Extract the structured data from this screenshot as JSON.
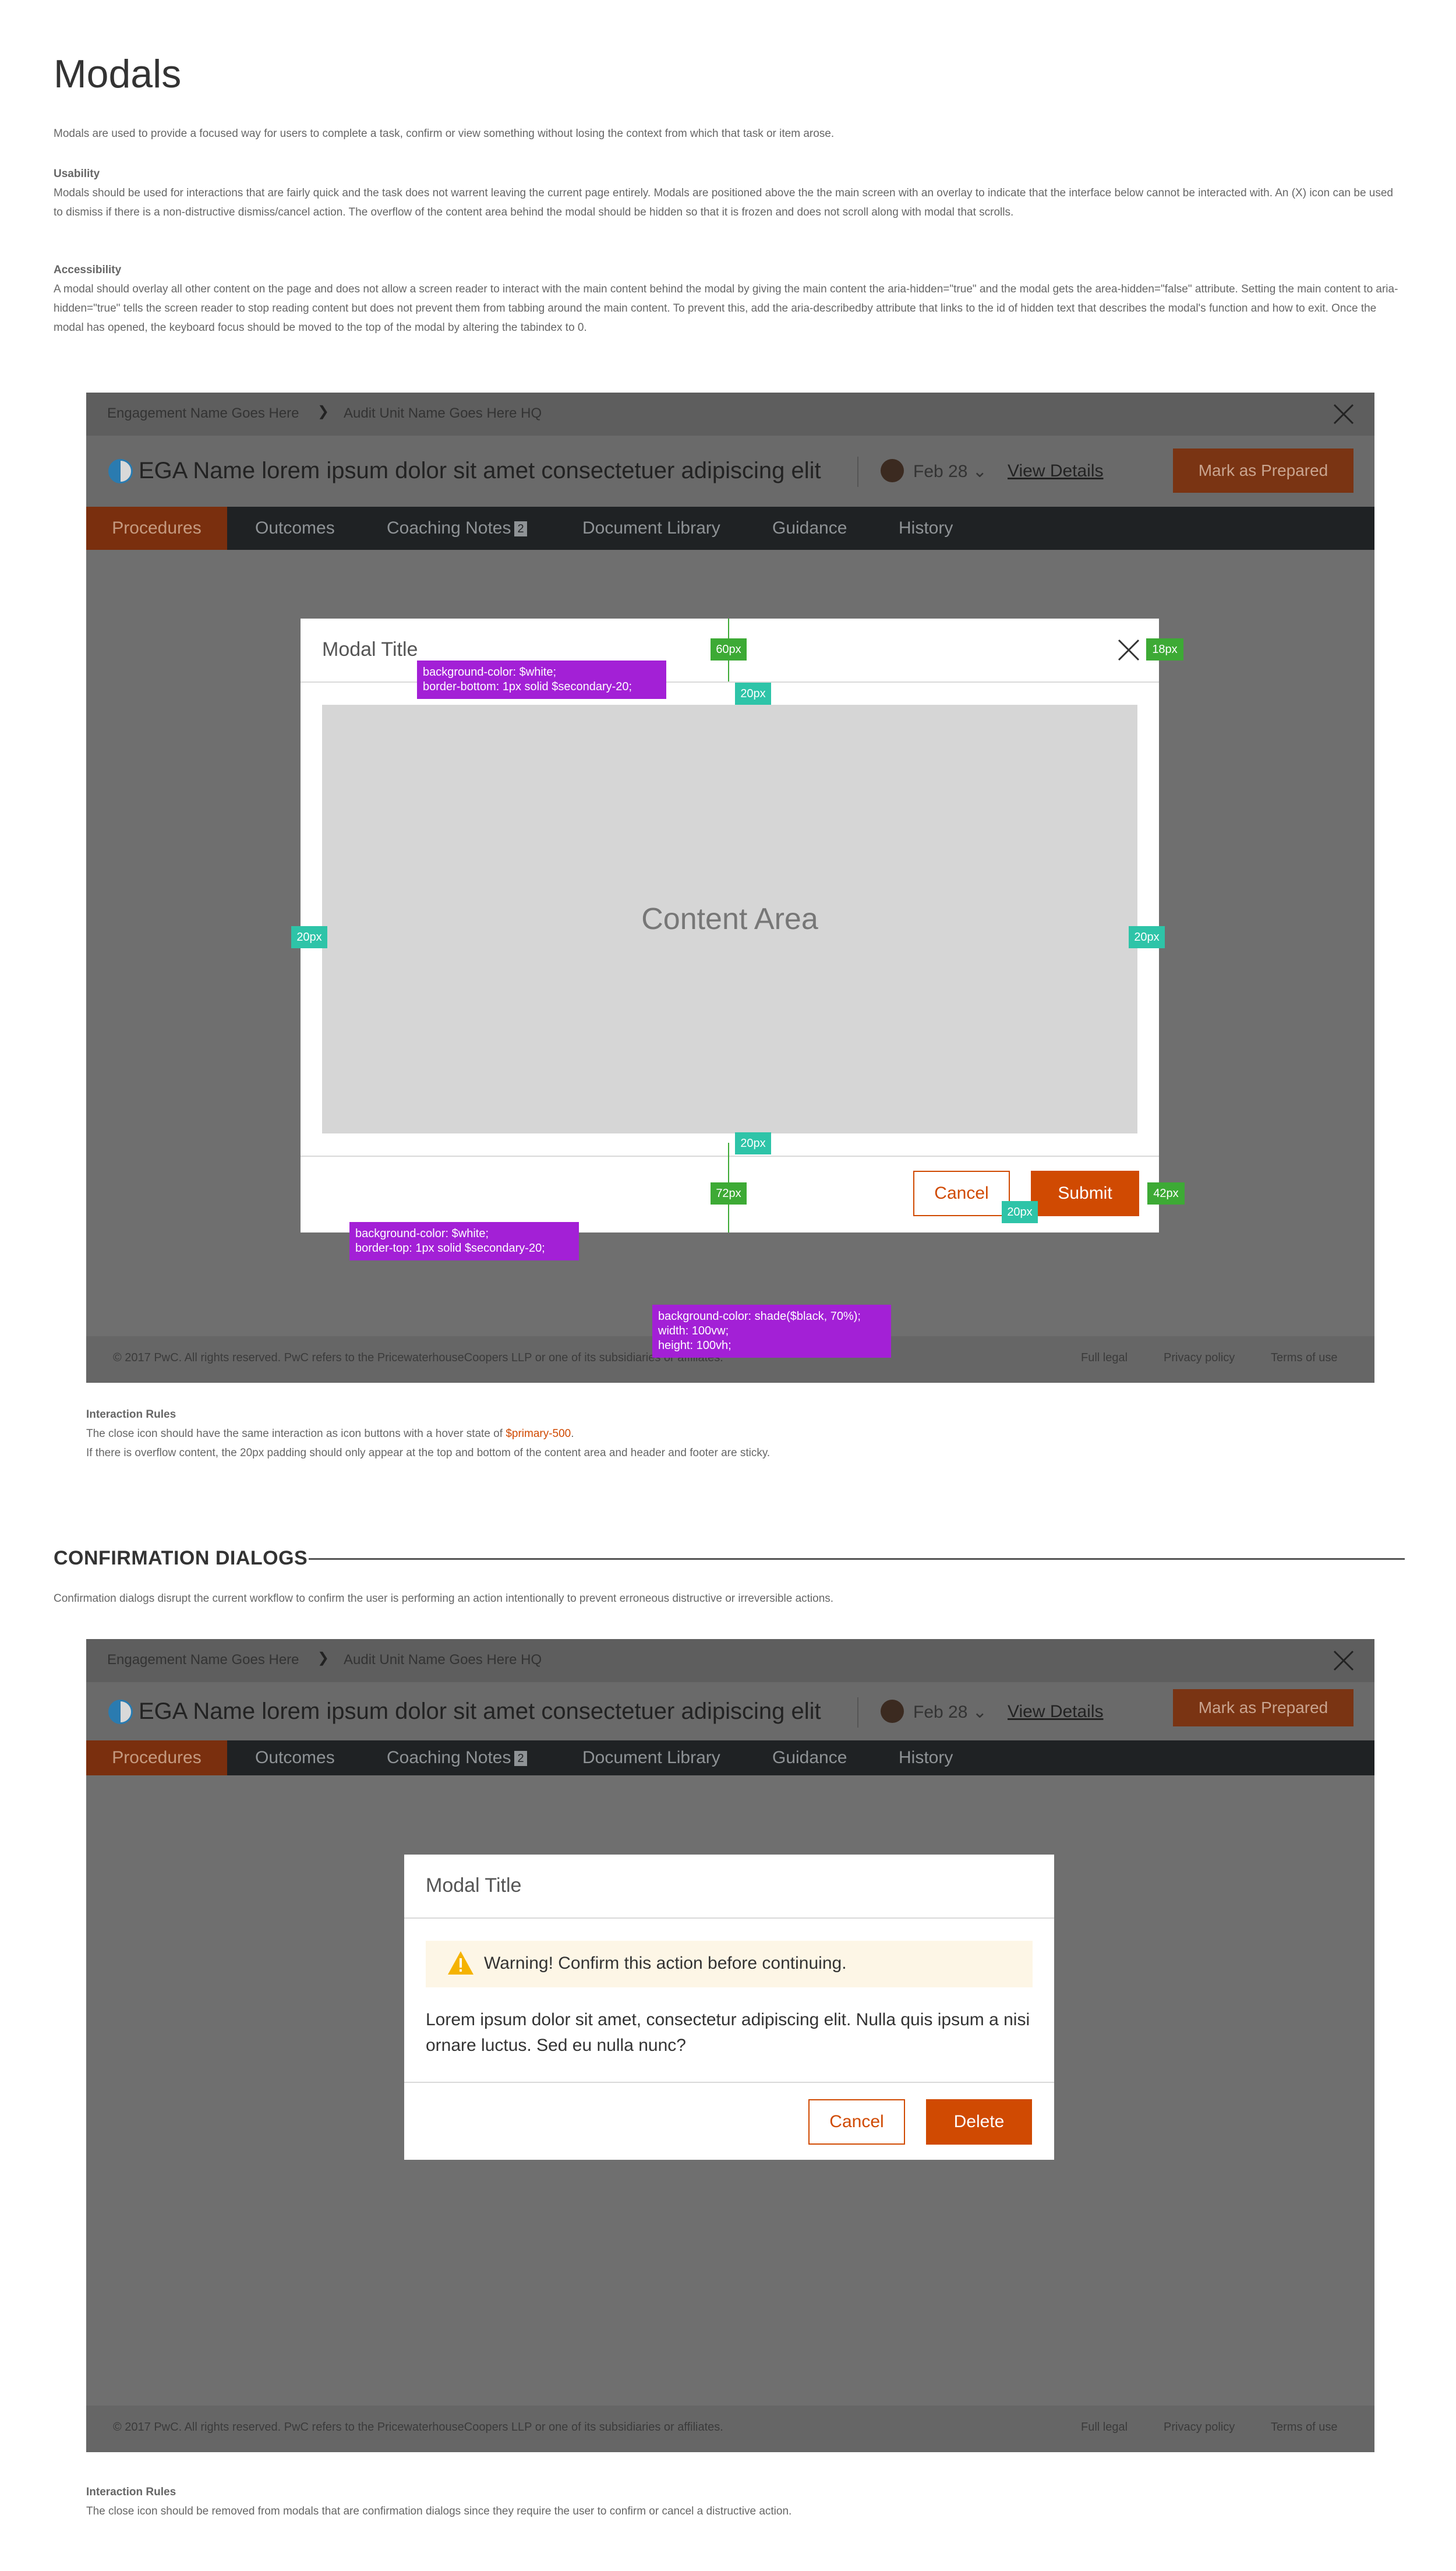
{
  "page": {
    "title": "Modals",
    "intro": "Modals are used to provide a focused way for users to complete a task, confirm or view something without losing the context from which that task or item arose.",
    "usability_label": "Usability",
    "usability_text": "Modals should be used for interactions that are fairly quick and the task does not warrent leaving the current page entirely. Modals are positioned above the the main screen with an overlay to indicate that the interface below cannot be interacted with. An (X) icon can be used to dismiss if there is a non-distructive dismiss/cancel action. The overflow of the content area behind the modal should be hidden so that it is frozen and does not scroll along with modal that scrolls.",
    "accessibility_label": "Accessibility",
    "accessibility_text": "A modal should overlay all other content on the page and does not allow a screen reader to interact with the main content behind the modal by giving the main content the aria-hidden=\"true\" and the modal gets the area-hidden=\"false\" attribute. Setting the main content to aria-hidden=\"true\" tells the screen reader to stop reading content but does not prevent them from tabbing around the main content. To prevent this, add the aria-describedby attribute that links to the id of hidden text that describes the modal's function and how to exit. Once the modal has opened, the keyboard focus should be moved to the top of the modal by altering the tabindex to 0."
  },
  "app": {
    "breadcrumb_1": "Engagement Name Goes Here",
    "breadcrumb_2": "Audit Unit Name Goes Here HQ",
    "ega_name": "EGA Name lorem ipsum dolor sit amet consectetuer adipiscing elit",
    "date": "Feb 28",
    "view_details": "View Details",
    "mark_prepared": "Mark as Prepared",
    "nav": [
      "Procedures",
      "Outcomes",
      "Coaching Notes",
      "Document Library",
      "Guidance",
      "History"
    ],
    "coaching_badge": "2",
    "footer_copy": "© 2017 PwC. All rights reserved. PwC refers to the PricewaterhouseCoopers LLP or one of its subsidiaries or affiliates.",
    "footer_links": [
      "Full legal",
      "Privacy policy",
      "Terms of use"
    ]
  },
  "modal1": {
    "title": "Modal Title",
    "content": "Content Area",
    "cancel": "Cancel",
    "submit": "Submit"
  },
  "annotations": {
    "m60": "60px",
    "m18": "18px",
    "m20a": "20px",
    "m20l": "20px",
    "m20r": "20px",
    "m20b": "20px",
    "m72": "72px",
    "m42": "42px",
    "m20btn": "20px",
    "header_note": "background-color: $white;\nborder-bottom: 1px solid $secondary-20;",
    "footer_note": "background-color: $white;\nborder-top: 1px solid $secondary-20;",
    "overlay_note": "background-color: shade($black, 70%);\nwidth: 100vw;\nheight: 100vh;"
  },
  "rules1": {
    "label": "Interaction Rules",
    "line1_pre": "The close icon should have the same interaction as icon buttons with a hover state of ",
    "line1_link": "$primary-500",
    "line1_post": ".",
    "line2": "If there is overflow content, the 20px padding should only appear at the top and bottom of the content area and header and footer are sticky."
  },
  "confirm": {
    "heading": "CONFIRMATION DIALOGS",
    "intro": "Confirmation dialogs disrupt the current workflow to confirm the user is performing an action intentionally to prevent erroneous distructive or irreversible actions."
  },
  "modal2": {
    "title": "Modal Title",
    "warning": "Warning! Confirm this action before continuing.",
    "body": "Lorem ipsum dolor sit amet, consectetur adipiscing elit. Nulla quis ipsum a nisi ornare luctus. Sed eu nulla nunc?",
    "cancel": "Cancel",
    "delete": "Delete"
  },
  "rules2": {
    "label": "Interaction Rules",
    "line1": "The close icon should be removed from modals that are confirmation dialogs since they require the user to confirm or cancel a distructive action."
  },
  "colors": {
    "primary": "#d04a02",
    "overlay": "#6f6f6f",
    "green": "#3daa35",
    "teal": "#2ec4a8",
    "purple": "#a320d6"
  }
}
